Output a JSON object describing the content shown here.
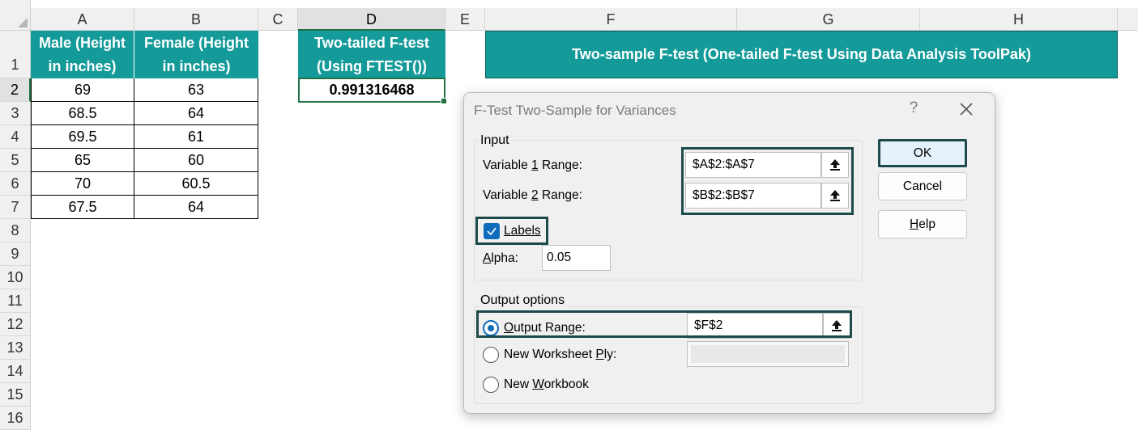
{
  "columns": [
    "A",
    "B",
    "C",
    "D",
    "E",
    "F",
    "G",
    "H"
  ],
  "rows": [
    "1",
    "2",
    "3",
    "4",
    "5",
    "6",
    "7",
    "8",
    "9",
    "10",
    "11",
    "12",
    "13",
    "14",
    "15",
    "16"
  ],
  "sheet": {
    "male_header_line1": "Male (Height",
    "male_header_line2": "in inches)",
    "female_header_line1": "Female (Height",
    "female_header_line2": "in inches)",
    "male_values": [
      "69",
      "68.5",
      "69.5",
      "65",
      "70",
      "67.5"
    ],
    "female_values": [
      "63",
      "64",
      "61",
      "60",
      "60.5",
      "64"
    ],
    "ftest_header_line1": "Two-tailed F-test",
    "ftest_header_line2": "(Using FTEST())",
    "ftest_value": "0.991316468",
    "banner": "Two-sample F-test (One-tailed F-test Using Data Analysis ToolPak)"
  },
  "dialog": {
    "title": "F-Test Two-Sample for Variances",
    "help_glyph": "?",
    "input_group": "Input",
    "var1_label_pre": "Variable ",
    "var1_label_key": "1",
    "var1_label_post": " Range:",
    "var1_value": "$A$2:$A$7",
    "var2_label_pre": "Variable ",
    "var2_label_key": "2",
    "var2_label_post": " Range:",
    "var2_value": "$B$2:$B$7",
    "labels_checkbox": "Labels",
    "labels_checked": true,
    "alpha_label_key": "A",
    "alpha_label_rest": "lpha:",
    "alpha_value": "0.05",
    "output_group": "Output options",
    "output_range_key": "O",
    "output_range_rest": "utput Range:",
    "output_range_value": "$F$2",
    "new_ws_pre": "New Worksheet ",
    "new_ws_key": "P",
    "new_ws_rest": "ly:",
    "new_ws_value": "",
    "new_wb_pre": "New ",
    "new_wb_key": "W",
    "new_wb_rest": "orkbook",
    "selected_output": "Output Range",
    "ok": "OK",
    "cancel": "Cancel",
    "help_key": "H",
    "help_rest": "elp"
  },
  "colors": {
    "teal_header": "#159a9a",
    "highlight_border": "#1d4b4b",
    "excel_green": "#217346",
    "checkbox_blue": "#0f6cbd"
  }
}
